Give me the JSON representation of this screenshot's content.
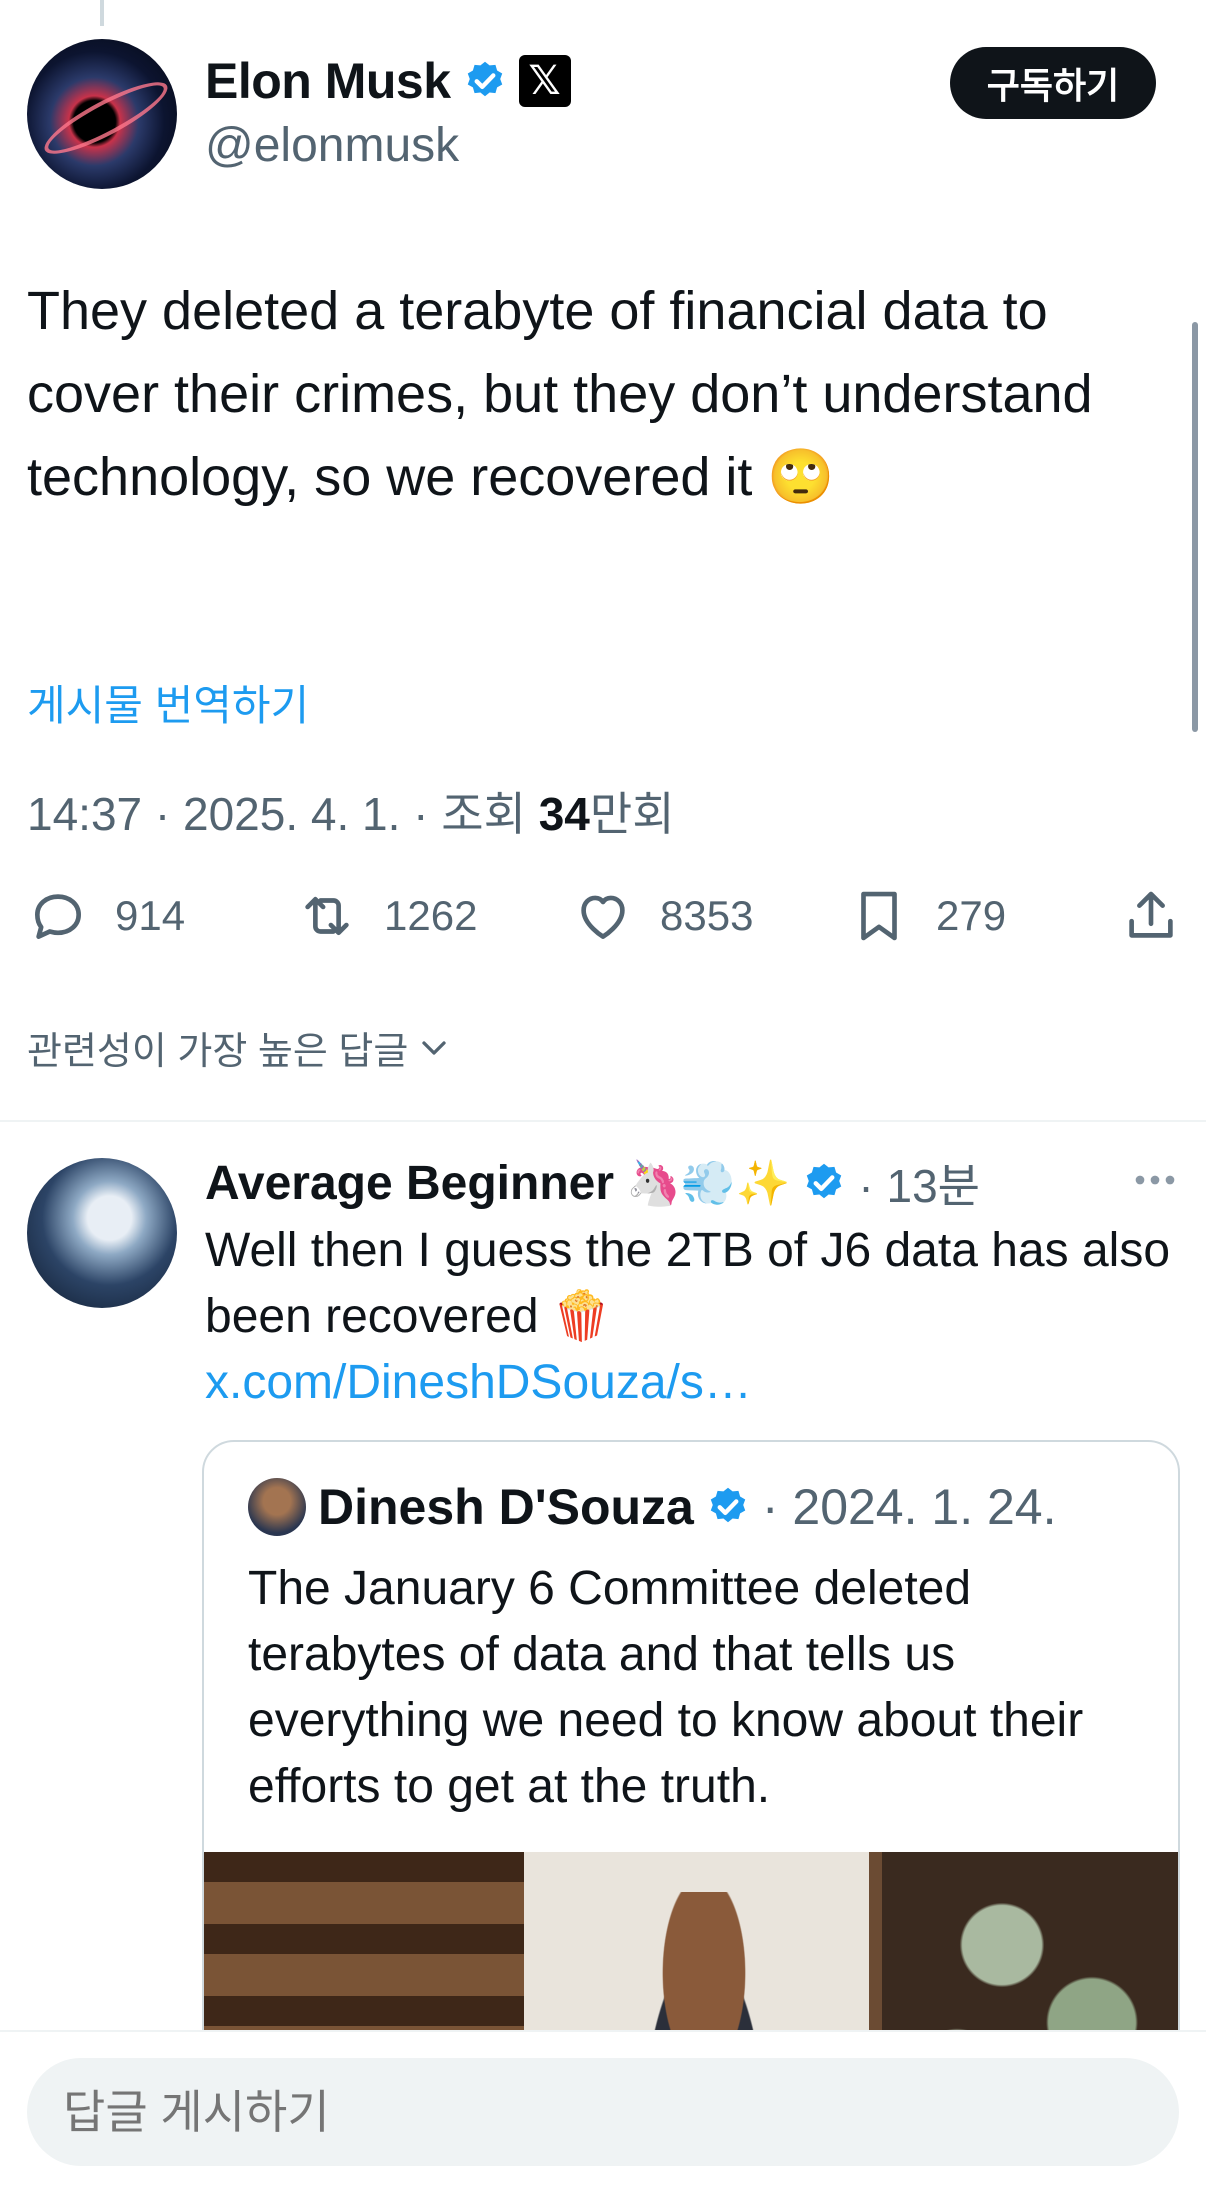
{
  "post": {
    "display_name": "Elon Musk",
    "handle": "@elonmusk",
    "subscribe_label": "구독하기",
    "text": "They deleted a terabyte of financial data to cover their crimes, but they don’t understand technology, so we recovered it 🙄",
    "translate_label": "게시물 번역하기",
    "meta_prefix": "14:37 · 2025. 4. 1. · 조회 ",
    "views_number": "34",
    "views_unit": "만회",
    "counts": {
      "replies": "914",
      "reposts": "1262",
      "likes": "8353",
      "bookmarks": "279"
    }
  },
  "sort_label": "관련성이 가장 높은 답글",
  "reply": {
    "display_name": "Average Beginner",
    "emojis": "🦄💨✨",
    "time": "· 13분",
    "text": "Well then I guess the 2TB of J6 data has also been recovered 🍿",
    "link": "x.com/DineshDSouza/s…"
  },
  "quote": {
    "display_name": "Dinesh D'Souza",
    "date": "· 2024. 1. 24.",
    "text": "The January 6 Committee deleted terabytes of data and that tells us everything we need to know about their efforts to get at the truth."
  },
  "composer": {
    "placeholder": "답글 게시하기"
  },
  "colors": {
    "accent": "#1d9bf0",
    "text": "#0f1419",
    "muted": "#536471"
  }
}
